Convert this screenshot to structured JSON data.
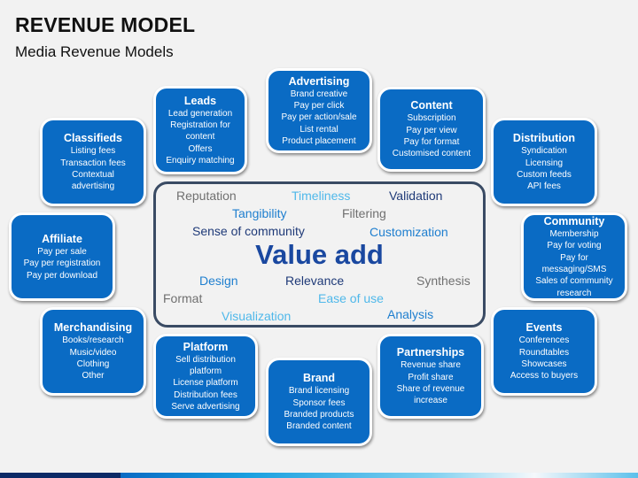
{
  "header": {
    "title": "REVENUE MODEL",
    "subtitle": "Media Revenue Models"
  },
  "cards": {
    "advertising": {
      "title": "Advertising",
      "items": [
        "Brand creative",
        "Pay per click",
        "Pay per action/sale",
        "List rental",
        "Product placement"
      ]
    },
    "leads": {
      "title": "Leads",
      "items": [
        "Lead generation",
        "Registration for",
        "content",
        "Offers",
        "Enquiry matching"
      ]
    },
    "content": {
      "title": "Content",
      "items": [
        "Subscription",
        "Pay per view",
        "Pay for format",
        "Customised content"
      ]
    },
    "classifieds": {
      "title": "Classifieds",
      "items": [
        "Listing fees",
        "Transaction fees",
        "Contextual",
        "advertising"
      ]
    },
    "distribution": {
      "title": "Distribution",
      "items": [
        "Syndication",
        "Licensing",
        "Custom feeds",
        "API fees"
      ]
    },
    "affiliate": {
      "title": "Affiliate",
      "items": [
        "Pay per sale",
        "Pay per registration",
        "Pay per download"
      ]
    },
    "community": {
      "title": "Community",
      "items": [
        "Membership",
        "Pay for voting",
        "Pay for",
        "messaging/SMS",
        "Sales of community",
        "research"
      ]
    },
    "merchandising": {
      "title": "Merchandising",
      "items": [
        "Books/research",
        "Music/video",
        "Clothing",
        "Other"
      ]
    },
    "events": {
      "title": "Events",
      "items": [
        "Conferences",
        "Roundtables",
        "Showcases",
        "Access to buyers"
      ]
    },
    "platform": {
      "title": "Platform",
      "items": [
        "Sell distribution",
        "platform",
        "License platform",
        "Distribution fees",
        "Serve advertising"
      ]
    },
    "partnerships": {
      "title": "Partnerships",
      "items": [
        "Revenue share",
        "Profit share",
        "Share of revenue",
        "increase"
      ]
    },
    "brand": {
      "title": "Brand",
      "items": [
        "Brand licensing",
        "Sponsor fees",
        "Branded products",
        "Branded content"
      ]
    }
  },
  "center": {
    "main": "Value add",
    "words": {
      "reputation": "Reputation",
      "timeliness": "Timeliness",
      "validation": "Validation",
      "tangibility": "Tangibility",
      "filtering": "Filtering",
      "sense_of_community": "Sense of community",
      "customization": "Customization",
      "design": "Design",
      "relevance": "Relevance",
      "synthesis": "Synthesis",
      "format": "Format",
      "ease_of_use": "Ease of use",
      "visualization": "Visualization",
      "analysis": "Analysis"
    }
  },
  "colors": {
    "card_fill": "#0a6bc4",
    "center_border": "#3a4b64",
    "value_add": "#1a48a0"
  }
}
